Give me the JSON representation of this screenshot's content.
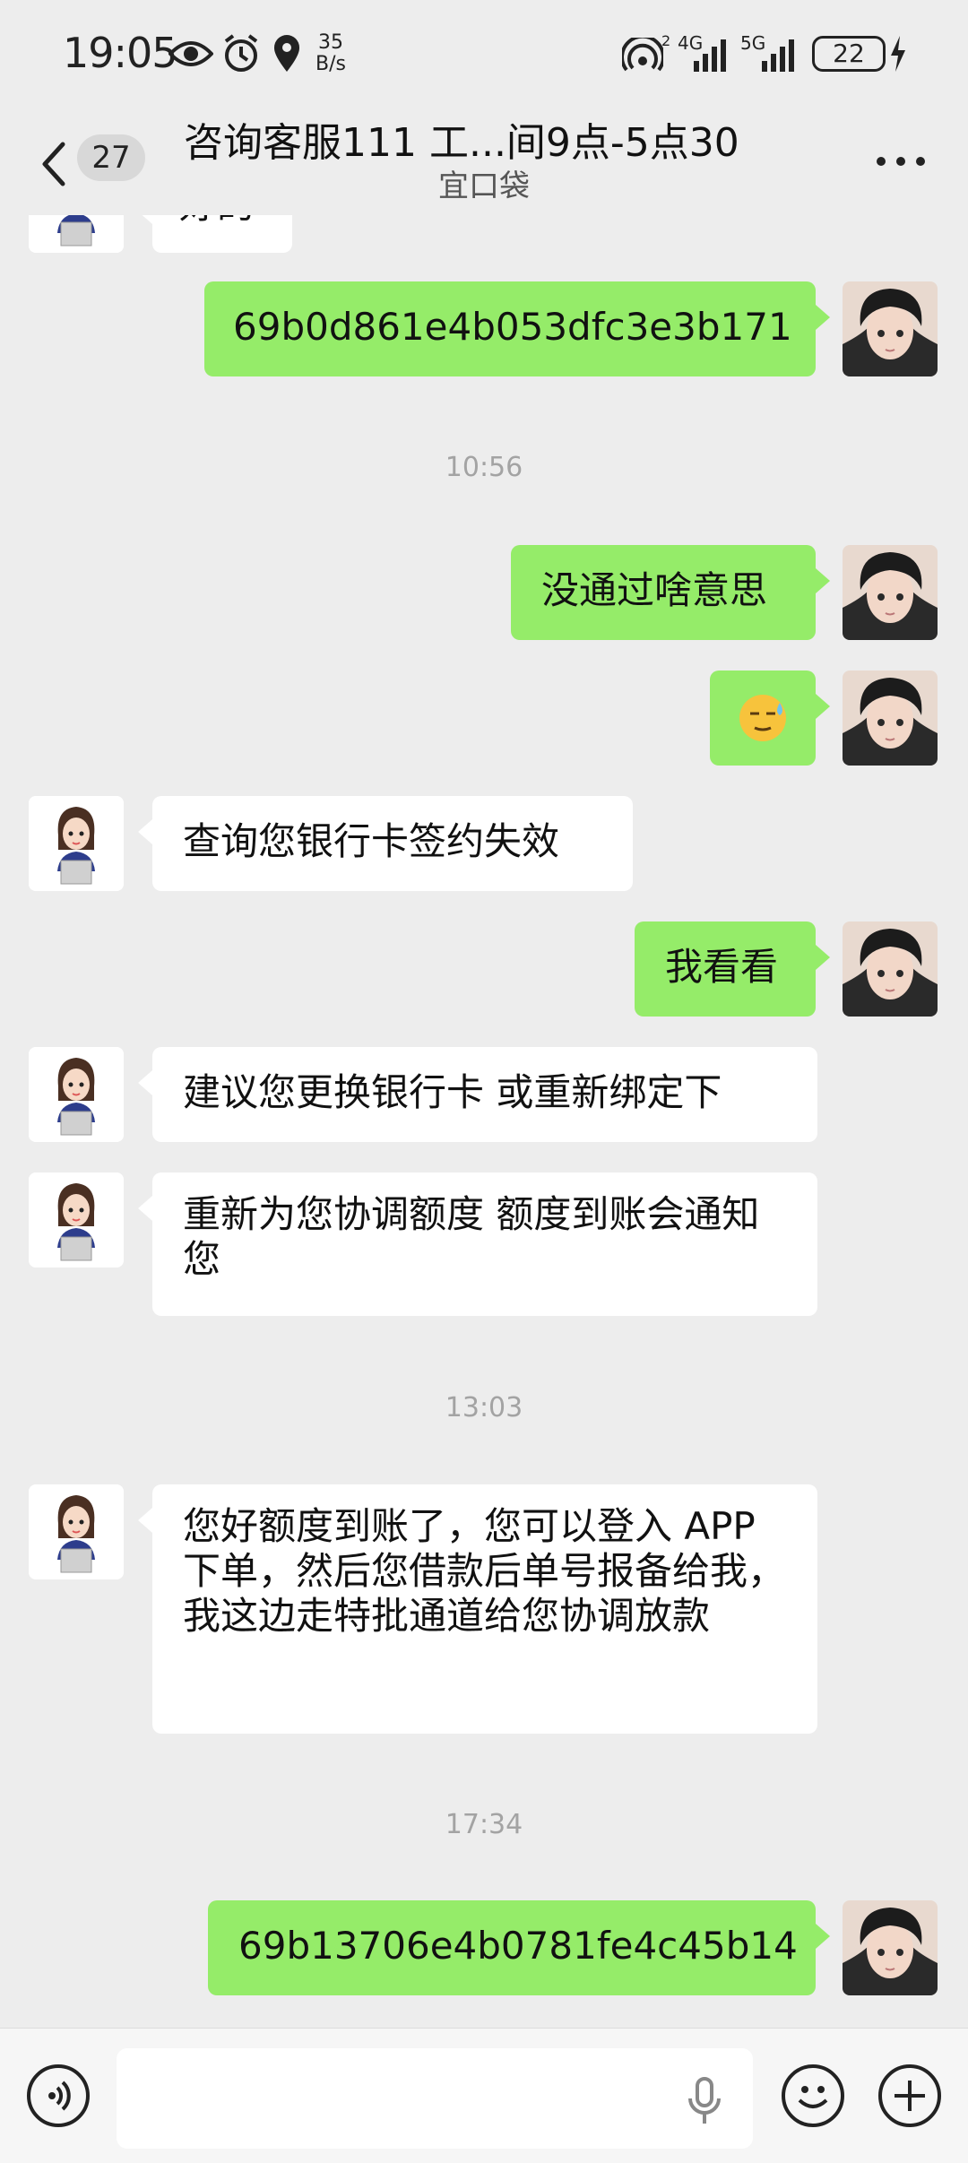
{
  "status_bar": {
    "time": "19:05",
    "speed_value": "35",
    "speed_unit": "B/s",
    "net1": "4G",
    "net2": "5G",
    "sup": "2",
    "battery": "22"
  },
  "header": {
    "unread_count": "27",
    "title": "咨询客服111 工...间9点-5点30",
    "subtitle": "宜口袋"
  },
  "messages": [
    {
      "type": "partial",
      "text": "好的"
    },
    {
      "type": "me",
      "text": "69b0d861e4b053dfc3e3b171"
    },
    {
      "type": "time",
      "text": "10:56"
    },
    {
      "type": "me",
      "text": "没通过啥意思"
    },
    {
      "type": "me_emoji",
      "text": "😓"
    },
    {
      "type": "them",
      "text": "查询您银行卡签约失效"
    },
    {
      "type": "me",
      "text": "我看看"
    },
    {
      "type": "them",
      "text": "建议您更换银行卡 或重新绑定下"
    },
    {
      "type": "them",
      "text": "重新为您协调额度 额度到账会通知您"
    },
    {
      "type": "time",
      "text": "13:03"
    },
    {
      "type": "them",
      "text": "您好额度到账了，您可以登入 APP 下单，然后您借款后单号报备给我，我这边走特批通道给您协调放款"
    },
    {
      "type": "time",
      "text": "17:34"
    },
    {
      "type": "me",
      "text": "69b13706e4b0781fe4c45b14"
    }
  ],
  "colors": {
    "me_bubble": "#95ec69",
    "them_bubble": "#ffffff",
    "background": "#ededed"
  }
}
